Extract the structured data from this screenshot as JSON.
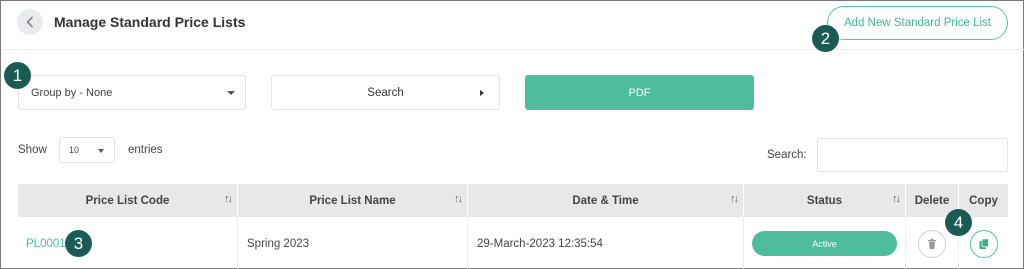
{
  "header": {
    "title": "Manage Standard Price Lists",
    "add_button_label": "Add New Standard Price List"
  },
  "toolbar": {
    "group_by_value": "Group by - None",
    "search_button_label": "Search",
    "pdf_button_label": "PDF"
  },
  "list_controls": {
    "show_label": "Show",
    "entries_value": "10",
    "entries_label": "entries",
    "search_label": "Search:",
    "search_value": ""
  },
  "table": {
    "columns": [
      "Price List Code",
      "Price List Name",
      "Date & Time",
      "Status",
      "Delete",
      "Copy"
    ],
    "sort_glyph": "↑↓",
    "rows": [
      {
        "code": "PL0001",
        "name": "Spring 2023",
        "datetime": "29-March-2023 12:35:54",
        "status": "Active"
      }
    ]
  },
  "callouts": [
    "1",
    "2",
    "3",
    "4"
  ],
  "icons": {
    "back": "chevron-left-icon",
    "delete": "trash-icon",
    "copy": "copy-icon"
  },
  "colors": {
    "accent": "#4dbd9c",
    "callout_badge": "#1a5c54",
    "table_header": "#e8e8e8"
  }
}
